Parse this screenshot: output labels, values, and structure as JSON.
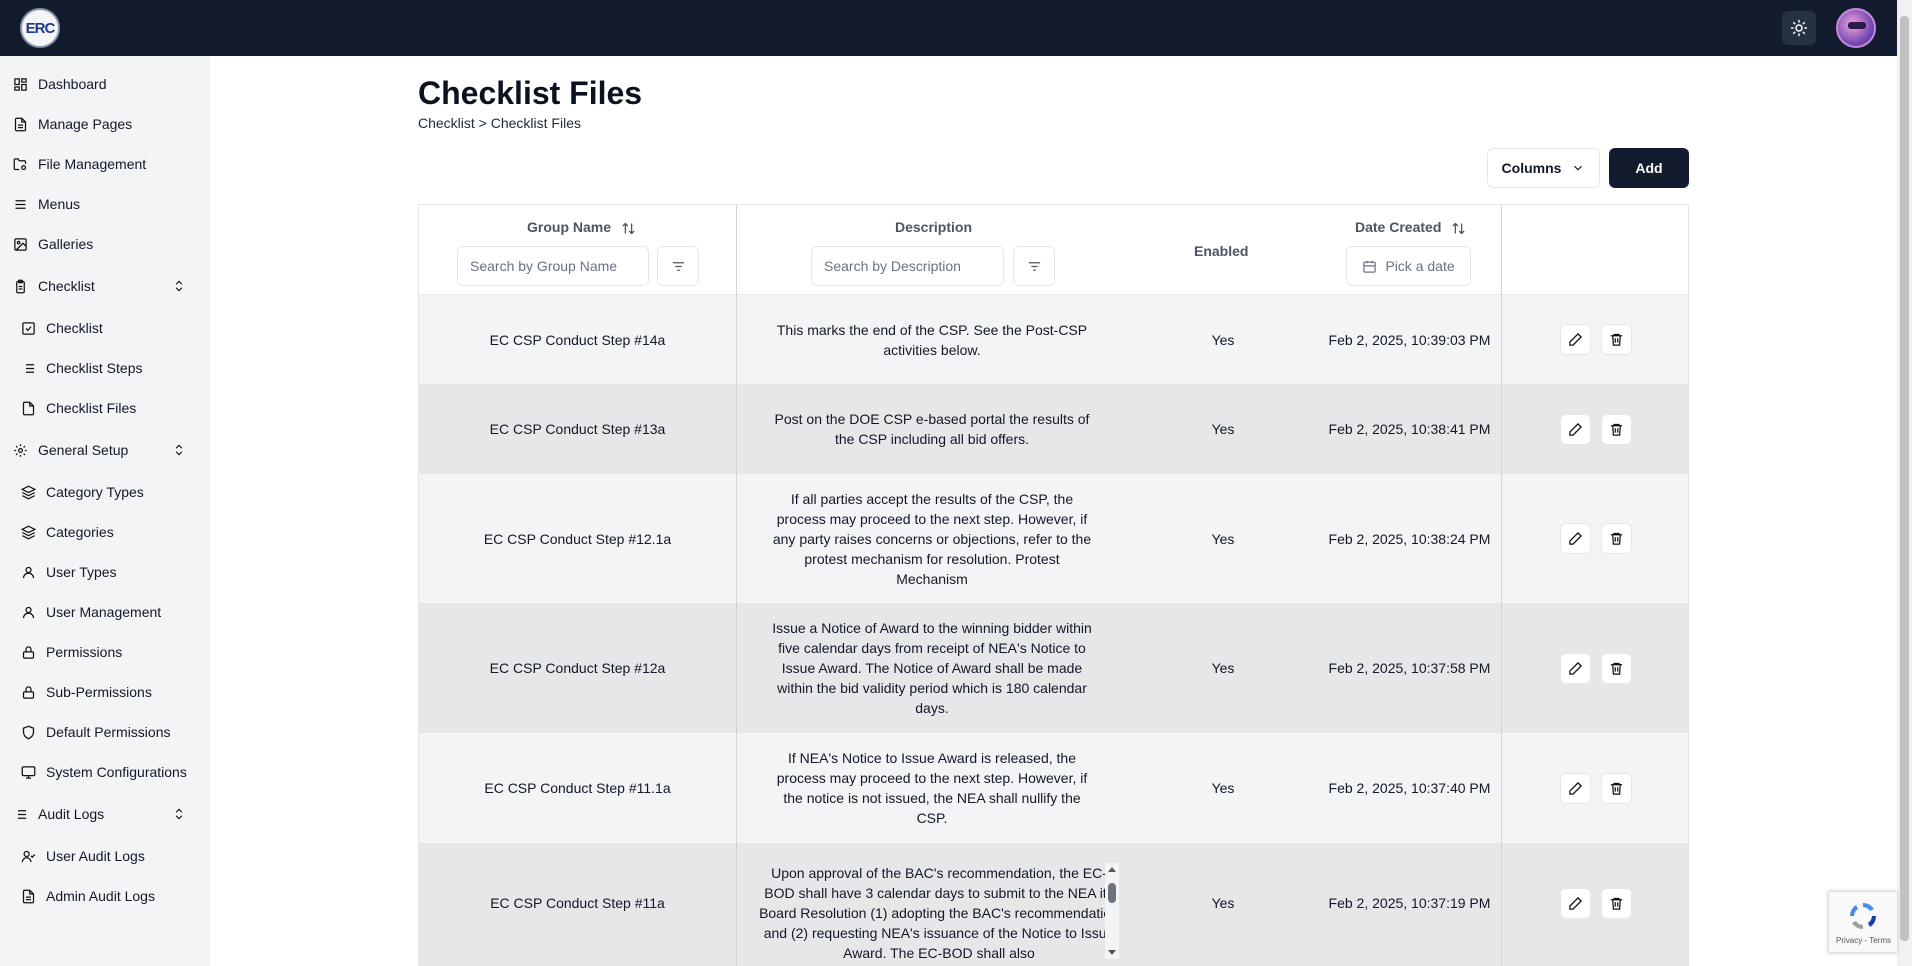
{
  "header": {
    "logo_text": "ERC",
    "theme_icon": "sun-icon",
    "avatar_icon": "user-avatar"
  },
  "sidebar": {
    "items": [
      {
        "label": "Dashboard",
        "icon": "dashboard-icon"
      },
      {
        "label": "Manage Pages",
        "icon": "page-icon"
      },
      {
        "label": "File Management",
        "icon": "folder-cog-icon"
      },
      {
        "label": "Menus",
        "icon": "menu-icon"
      },
      {
        "label": "Galleries",
        "icon": "image-icon"
      },
      {
        "label": "Checklist",
        "icon": "clipboard-icon",
        "expandable": true
      },
      {
        "label": "Checklist",
        "icon": "check-square-icon"
      },
      {
        "label": "Checklist Steps",
        "icon": "list-icon"
      },
      {
        "label": "Checklist Files",
        "icon": "file-icon"
      },
      {
        "label": "General Setup",
        "icon": "gear-icon",
        "expandable": true
      },
      {
        "label": "Category Types",
        "icon": "layers-icon"
      },
      {
        "label": "Categories",
        "icon": "layers-icon"
      },
      {
        "label": "User Types",
        "icon": "user-icon"
      },
      {
        "label": "User Management",
        "icon": "user-icon"
      },
      {
        "label": "Permissions",
        "icon": "lock-icon"
      },
      {
        "label": "Sub-Permissions",
        "icon": "lock-icon"
      },
      {
        "label": "Default Permissions",
        "icon": "shield-icon"
      },
      {
        "label": "System Configurations",
        "icon": "monitor-cog-icon"
      },
      {
        "label": "Audit Logs",
        "icon": "list-icon",
        "expandable": true
      },
      {
        "label": "User Audit Logs",
        "icon": "user-check-icon"
      },
      {
        "label": "Admin Audit Logs",
        "icon": "file-text-icon"
      }
    ]
  },
  "main": {
    "title": "Checklist Files",
    "breadcrumb": "Checklist > Checklist Files",
    "columns_label": "Columns",
    "add_label": "Add"
  },
  "table": {
    "headers": {
      "group_name": "Group Name",
      "description": "Description",
      "enabled": "Enabled",
      "date_created": "Date Created"
    },
    "search_group_placeholder": "Search by Group Name",
    "search_desc_placeholder": "Search by Description",
    "date_placeholder": "Pick a date",
    "rows": [
      {
        "group": "EC CSP Conduct Step #14a",
        "description": "This marks the end of the CSP. See the Post-CSP activities below.",
        "enabled": "Yes",
        "date": "Feb 2, 2025, 10:39:03 PM"
      },
      {
        "group": "EC CSP Conduct Step #13a",
        "description": "Post on the DOE CSP e-based portal the results of the CSP including all bid offers.",
        "enabled": "Yes",
        "date": "Feb 2, 2025, 10:38:41 PM"
      },
      {
        "group": "EC CSP Conduct Step #12.1a",
        "description": "If all parties accept the results of the CSP, the process may proceed to the next step. However, if any party raises concerns or objections, refer to the protest mechanism for resolution. Protest Mechanism",
        "enabled": "Yes",
        "date": "Feb 2, 2025, 10:38:24 PM"
      },
      {
        "group": "EC CSP Conduct Step #12a",
        "description": "Issue a Notice of Award to the winning bidder within five calendar days from receipt of NEA's Notice to Issue Award.  The Notice of Award shall be made within the bid validity period which is 180 calendar days.",
        "enabled": "Yes",
        "date": "Feb 2, 2025, 10:37:58 PM"
      },
      {
        "group": "EC CSP Conduct Step #11.1a",
        "description": "If NEA's Notice to Issue Award is released, the process may proceed to the next step. However, if the notice is not issued, the NEA shall nullify the CSP.",
        "enabled": "Yes",
        "date": "Feb 2, 2025, 10:37:40 PM"
      },
      {
        "group": "EC CSP Conduct Step #11a",
        "description": "Upon approval of the BAC's recommendation, the EC-BOD shall have 3 calendar days to submit to the NEA its Board Resolution (1) adopting the BAC's recommendation and (2) requesting NEA's issuance of the Notice to Issue Award. The EC-BOD shall also",
        "enabled": "Yes",
        "date": "Feb 2, 2025, 10:37:19 PM"
      }
    ]
  },
  "recaptcha": {
    "links": "Privacy - Terms"
  }
}
